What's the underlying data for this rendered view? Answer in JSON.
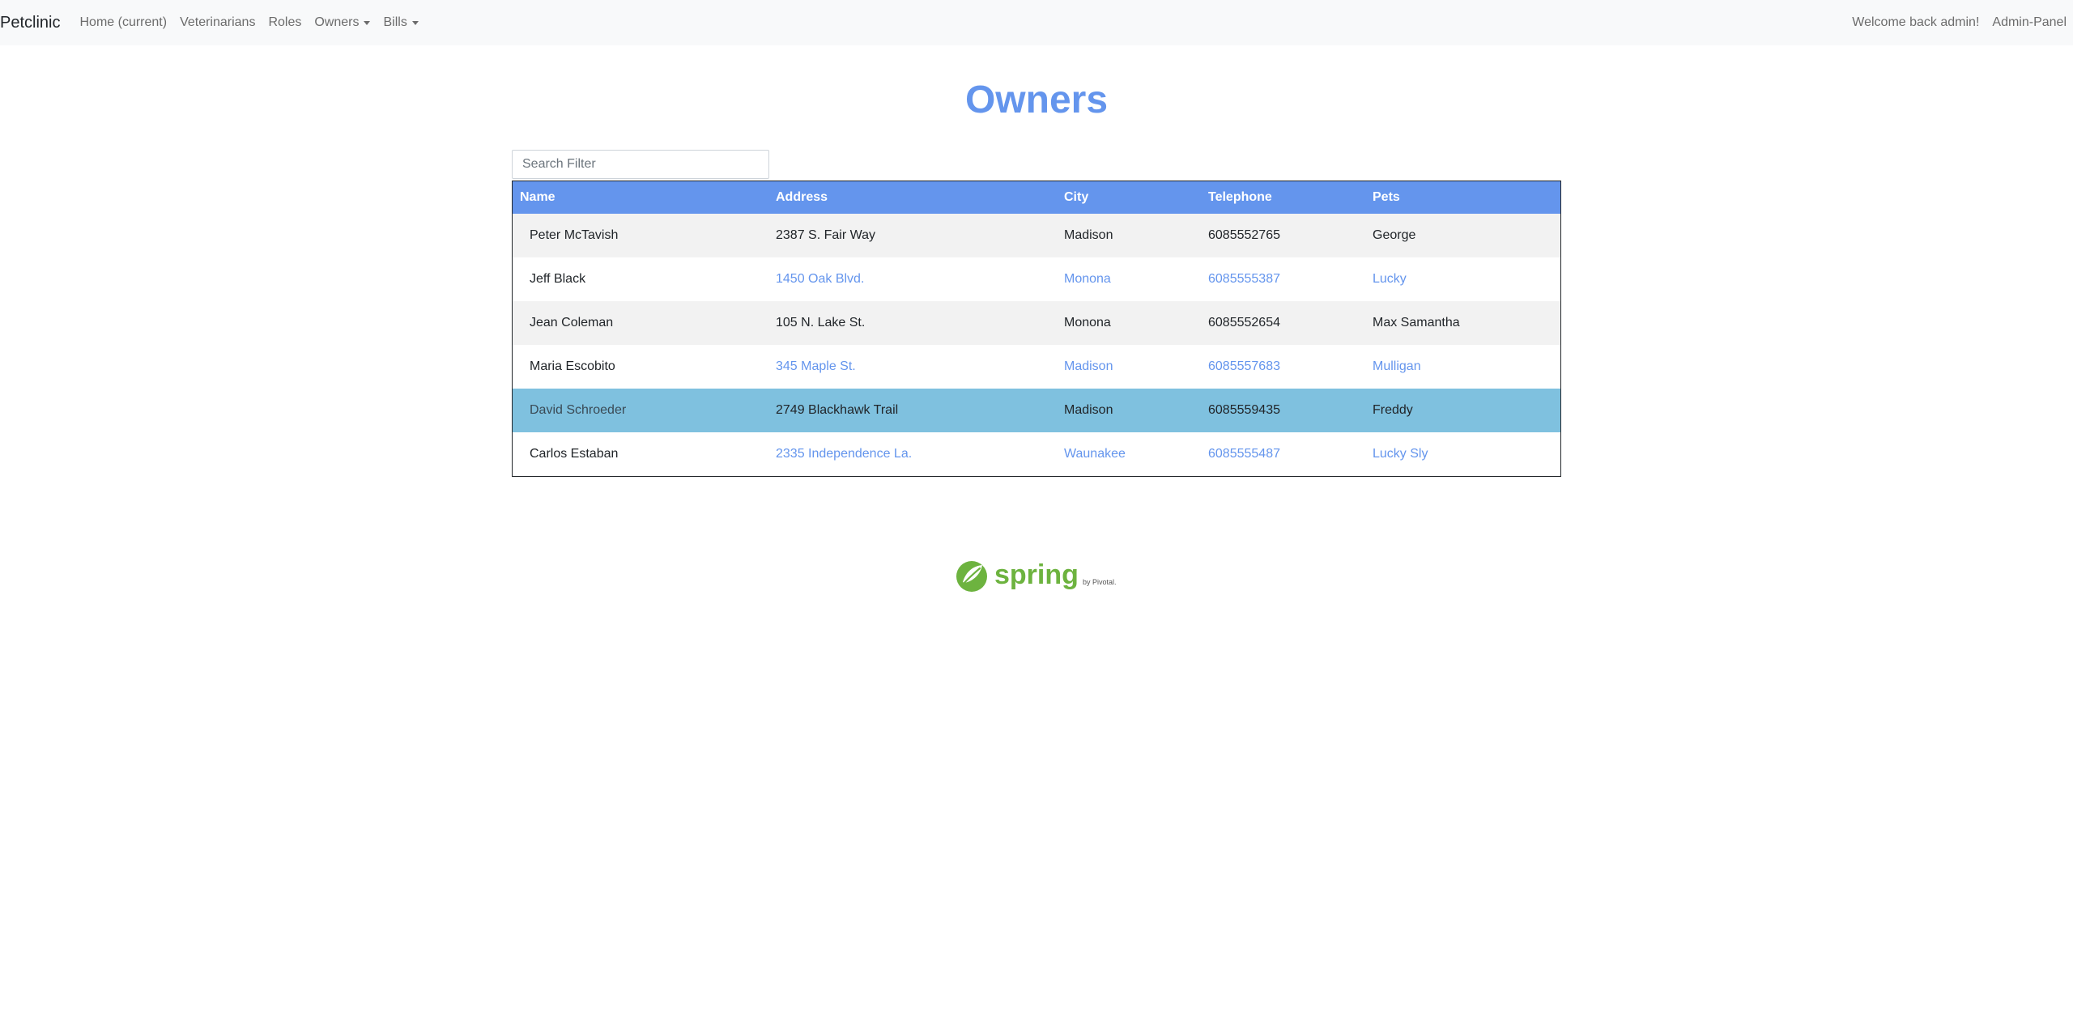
{
  "navbar": {
    "brand": "Petclinic",
    "links": [
      {
        "label": "Home (current)"
      },
      {
        "label": "Veterinarians"
      },
      {
        "label": "Roles"
      },
      {
        "label": "Owners"
      },
      {
        "label": "Bills"
      }
    ],
    "welcome": "Welcome back admin!",
    "admin_panel": "Admin-Panel"
  },
  "page": {
    "title": "Owners",
    "title_color": "#6495ed"
  },
  "search": {
    "placeholder": "Search Filter",
    "value": ""
  },
  "table": {
    "header_color": "#6495ed",
    "highlight_color": "#7fc1df",
    "columns": [
      "Name",
      "Address",
      "City",
      "Telephone",
      "Pets"
    ],
    "rows": [
      {
        "name": "Peter McTavish",
        "address": "2387 S. Fair Way",
        "city": "Madison",
        "telephone": "6085552765",
        "pets": "George"
      },
      {
        "name": "Jeff Black",
        "address": "1450 Oak Blvd.",
        "city": "Monona",
        "telephone": "6085555387",
        "pets": "Lucky"
      },
      {
        "name": "Jean Coleman",
        "address": "105 N. Lake St.",
        "city": "Monona",
        "telephone": "6085552654",
        "pets": "Max Samantha"
      },
      {
        "name": "Maria Escobito",
        "address": "345 Maple St.",
        "city": "Madison",
        "telephone": "6085557683",
        "pets": "Mulligan"
      },
      {
        "name": "David Schroeder",
        "address": "2749 Blackhawk Trail",
        "city": "Madison",
        "telephone": "6085559435",
        "pets": "Freddy"
      },
      {
        "name": "Carlos Estaban",
        "address": "2335 Independence La.",
        "city": "Waunakee",
        "telephone": "6085555487",
        "pets": "Lucky Sly"
      }
    ]
  },
  "footer": {
    "logo_text": "spring",
    "logo_subtext": "by Pivotal.",
    "logo_color": "#6db33f"
  }
}
